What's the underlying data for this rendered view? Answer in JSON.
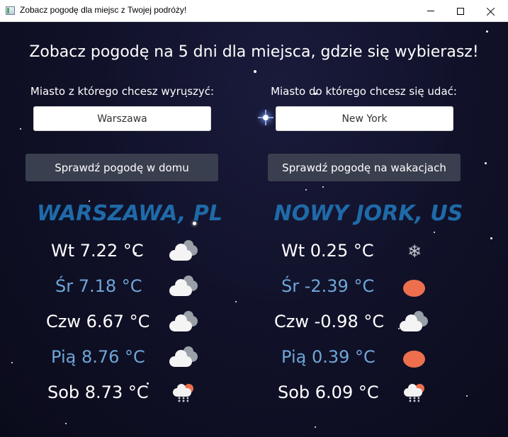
{
  "window": {
    "title": "Zobacz pogodę dla miejsc z Twojej podróży!"
  },
  "main": {
    "heading": "Zobacz pogodę na 5 dni dla miejsca, gdzie się wybierasz!",
    "from_label": "Miasto z którego chcesz wyruszyć:",
    "to_label": "Miasto do którego chcesz się udać:",
    "from_value": "Warszawa",
    "to_value": "New York",
    "home_button": "Sprawdź pogodę w domu",
    "vacation_button": "Sprawdź pogodę na wakacjach"
  },
  "home": {
    "city": "WARSZAWA, PL",
    "days": [
      {
        "text": "Wt 7.22 °C",
        "icon": "cloud-icon"
      },
      {
        "text": "Śr 7.18 °C",
        "icon": "cloud-icon"
      },
      {
        "text": "Czw 6.67 °C",
        "icon": "cloud-icon"
      },
      {
        "text": "Pią 8.76 °C",
        "icon": "cloud-icon"
      },
      {
        "text": "Sob 8.73 °C",
        "icon": "rain-sun-icon"
      }
    ]
  },
  "vacation": {
    "city": "NOWY JORK, US",
    "days": [
      {
        "text": "Wt 0.25 °C",
        "icon": "snowflake-icon"
      },
      {
        "text": "Śr -2.39 °C",
        "icon": "sun-icon"
      },
      {
        "text": "Czw -0.98 °C",
        "icon": "cloud-icon"
      },
      {
        "text": "Pią 0.39 °C",
        "icon": "sun-icon"
      },
      {
        "text": "Sob 6.09 °C",
        "icon": "rain-sun-icon"
      }
    ]
  },
  "colors": {
    "city_name": "#1f6aa8",
    "highlight_text": "#6fa6d8",
    "button_bg": "#3a3f4f",
    "sun": "#ee6f4e"
  }
}
